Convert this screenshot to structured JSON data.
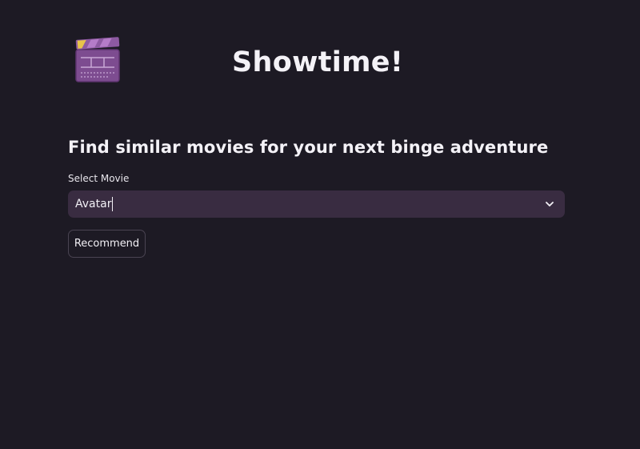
{
  "app": {
    "title": "Showtime!",
    "logo_icon": "clapperboard-icon"
  },
  "main": {
    "subtitle": "Find similar movies for your next binge adventure",
    "movie_select": {
      "label": "Select Movie",
      "value": "Avatar",
      "dropdown_icon": "chevron-down-icon"
    },
    "recommend_button": {
      "label": "Recommend"
    }
  },
  "colors": {
    "background": "#1d1a24",
    "select_background": "#392c41",
    "text": "#f2f0f5",
    "logo_purple": "#8a5a9c",
    "logo_yellow": "#e8c44a"
  }
}
